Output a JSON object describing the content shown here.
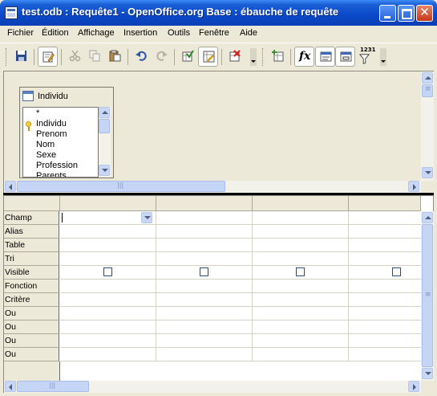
{
  "window": {
    "title": "test.odb : Requête1 - OpenOffice.org Base : ébauche de requête",
    "close_glyph": "✕"
  },
  "menubar": {
    "items": [
      {
        "label": "Fichier"
      },
      {
        "label": "Édition"
      },
      {
        "label": "Affichage"
      },
      {
        "label": "Insertion"
      },
      {
        "label": "Outils"
      },
      {
        "label": "Fenêtre"
      },
      {
        "label": "Aide"
      }
    ]
  },
  "toolbar": {
    "buttons": [
      {
        "icon": "save-icon"
      },
      {
        "icon": "edit-mode-icon",
        "active": true
      },
      {
        "icon": "cut-icon",
        "disabled": true
      },
      {
        "icon": "copy-icon",
        "disabled": true
      },
      {
        "icon": "paste-icon"
      },
      {
        "icon": "undo-icon"
      },
      {
        "icon": "redo-icon",
        "disabled": true
      },
      {
        "icon": "run-query-icon"
      },
      {
        "icon": "design-view-icon",
        "active": true
      },
      {
        "icon": "clear-query-icon"
      },
      {
        "icon": "add-table-icon"
      },
      {
        "icon": "functions-icon",
        "active": true
      },
      {
        "icon": "table-name-icon",
        "active": true
      },
      {
        "icon": "alias-icon",
        "active": true
      },
      {
        "icon": "distinct-values-icon"
      }
    ],
    "functions_glyph": "fx",
    "distinct_glyph": "1231"
  },
  "table_window": {
    "title": "Individu",
    "fields": [
      "*",
      "Individu",
      "Prenom",
      "Nom",
      "Sexe",
      "Profession",
      "Parents"
    ],
    "primary_key_field": "Individu"
  },
  "query_grid": {
    "rows": [
      "Champ",
      "Alias",
      "Table",
      "Tri",
      "Visible",
      "Fonction",
      "Critère",
      "Ou",
      "Ou",
      "Ou",
      "Ou"
    ],
    "visible_checked": [
      false,
      false,
      false,
      false
    ]
  },
  "upper_scroll": {
    "horizontal_grip": "|||",
    "vertical_grip": "≡"
  },
  "grid_scroll": {
    "horizontal_grip": "|||",
    "vertical_grip": "≡"
  }
}
